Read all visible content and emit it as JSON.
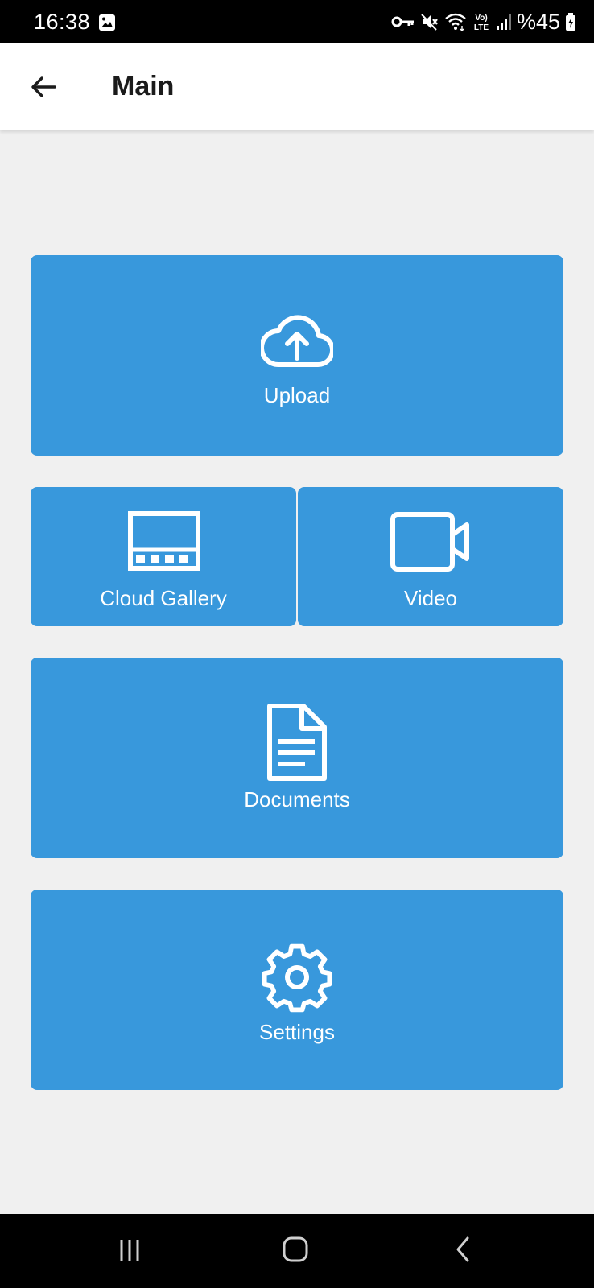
{
  "status_bar": {
    "time": "16:38",
    "battery": "%45",
    "icons": [
      "image-icon",
      "key-icon",
      "mute-icon",
      "wifi-icon",
      "volte-icon",
      "signal-icon",
      "battery-icon"
    ]
  },
  "app_bar": {
    "title": "Main",
    "back_icon": "arrow-left-icon"
  },
  "tiles": {
    "upload": {
      "label": "Upload",
      "icon": "cloud-upload-icon"
    },
    "cloud_gallery": {
      "label": "Cloud Gallery",
      "icon": "film-strip-icon"
    },
    "video": {
      "label": "Video",
      "icon": "video-camera-icon"
    },
    "documents": {
      "label": "Documents",
      "icon": "document-icon"
    },
    "settings": {
      "label": "Settings",
      "icon": "gear-icon"
    }
  },
  "nav_bar": {
    "icons": [
      "recents-icon",
      "home-icon",
      "back-icon"
    ]
  },
  "colors": {
    "tile_background": "#3898dc",
    "page_background": "#f0f0f0",
    "app_bar_background": "#ffffff",
    "system_bars": "#000000"
  }
}
